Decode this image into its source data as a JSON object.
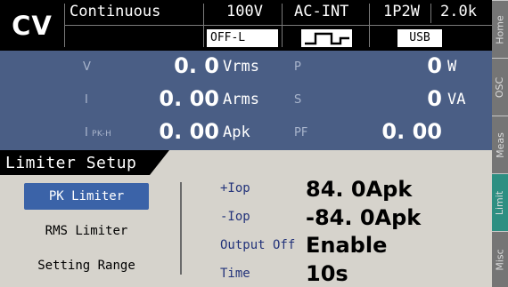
{
  "colors": {
    "meas_panel_bg": "#4a5e85",
    "active_menu_bg": "#3b63a8",
    "active_tab_bg": "#2e8f82",
    "body_bg": "#d6d3cc"
  },
  "status_bar": {
    "mode": "CV",
    "operation": "Continuous",
    "range": "100V",
    "output_state": "OFF-L",
    "source": "AC-INT",
    "waveform_icon": "square-wave-icon",
    "wiring": "1P2W",
    "frequency_range": "2.0k",
    "interface": "USB"
  },
  "measurements": {
    "left": [
      {
        "label": "V",
        "sub": "",
        "value": "0. 0",
        "unit": "Vrms"
      },
      {
        "label": "I",
        "sub": "",
        "value": "0. 00",
        "unit": "Arms"
      },
      {
        "label": "I",
        "sub": "PK-H",
        "value": "0. 00",
        "unit": "Apk"
      }
    ],
    "right": [
      {
        "label": "P",
        "value": "0",
        "unit": "W"
      },
      {
        "label": "S",
        "value": "0",
        "unit": "VA"
      },
      {
        "label": "PF",
        "value": "0. 00",
        "unit": ""
      }
    ]
  },
  "page": {
    "title": "Limiter Setup"
  },
  "menu": {
    "items": [
      {
        "label": "PK Limiter",
        "active": true
      },
      {
        "label": "RMS Limiter",
        "active": false
      },
      {
        "label": "Setting Range",
        "active": false
      }
    ]
  },
  "params": [
    {
      "label": "+Iop",
      "value": "84. 0Apk"
    },
    {
      "label": "-Iop",
      "value": "-84. 0Apk"
    },
    {
      "label": "Output Off",
      "value": "Enable"
    },
    {
      "label": "Time",
      "value": "10s"
    }
  ],
  "side_tabs": [
    {
      "label": "Home",
      "active": false
    },
    {
      "label": "OSC",
      "active": false
    },
    {
      "label": "Meas",
      "active": false
    },
    {
      "label": "Limit",
      "active": true
    },
    {
      "label": "Misc",
      "active": false
    }
  ]
}
